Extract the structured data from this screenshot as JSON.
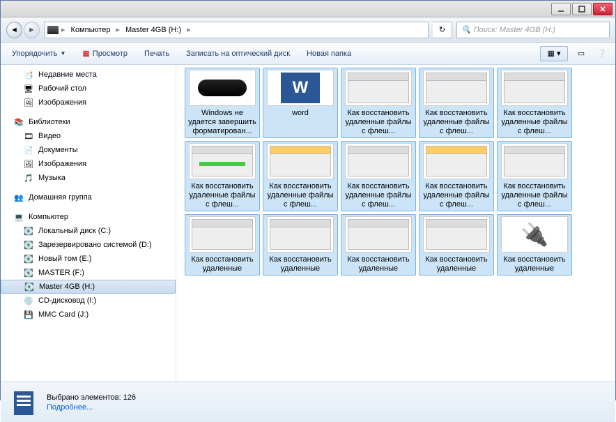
{
  "breadcrumb": {
    "root": "Компьютер",
    "current": "Master 4GB (H:)"
  },
  "search": {
    "placeholder": "Поиск: Master 4GB (H:)"
  },
  "toolbar": {
    "organize": "Упорядочить",
    "preview": "Просмотр",
    "print": "Печать",
    "burn": "Записать на оптический диск",
    "newfolder": "Новая папка"
  },
  "sidebar": {
    "fav": [
      {
        "label": "Недавние места",
        "icon": "📑"
      },
      {
        "label": "Рабочий стол",
        "icon": "🖥"
      },
      {
        "label": "Изображения",
        "icon": "🖼"
      }
    ],
    "lib_header": "Библиотеки",
    "lib": [
      {
        "label": "Видео",
        "icon": "🎞"
      },
      {
        "label": "Документы",
        "icon": "📄"
      },
      {
        "label": "Изображения",
        "icon": "🖼"
      },
      {
        "label": "Музыка",
        "icon": "🎵"
      }
    ],
    "home": "Домашняя группа",
    "comp_header": "Компьютер",
    "drives": [
      {
        "label": "Локальный диск (C:)",
        "icon": "💽"
      },
      {
        "label": "Зарезервировано системой (D:)",
        "icon": "💽"
      },
      {
        "label": "Новый том (E:)",
        "icon": "💽"
      },
      {
        "label": "MASTER (F:)",
        "icon": "💽"
      },
      {
        "label": "Master 4GB (H:)",
        "icon": "💽",
        "selected": true
      },
      {
        "label": "CD-дисковод (I:)",
        "icon": "💿"
      },
      {
        "label": "MMC Card (J:)",
        "icon": "💾"
      }
    ]
  },
  "files": [
    {
      "label": "Windows не удается завершить форматирован...",
      "t": "usb"
    },
    {
      "label": "word",
      "t": "word"
    },
    {
      "label": "Как восстановить удаленные файлы с флеш...",
      "t": "app"
    },
    {
      "label": "Как восстановить удаленные файлы с флеш...",
      "t": "app"
    },
    {
      "label": "Как восстановить удаленные файлы с флеш...",
      "t": "app"
    },
    {
      "label": "Как восстановить удаленные файлы с флеш...",
      "t": "green"
    },
    {
      "label": "Как восстановить удаленные файлы с флеш...",
      "t": "yellow"
    },
    {
      "label": "Как восстановить удаленные файлы с флеш...",
      "t": "app"
    },
    {
      "label": "Как восстановить удаленные файлы с флеш...",
      "t": "yellow"
    },
    {
      "label": "Как восстановить удаленные файлы с флеш...",
      "t": "app"
    },
    {
      "label": "Как восстановить удаленные",
      "t": "app"
    },
    {
      "label": "Как восстановить удаленные",
      "t": "app"
    },
    {
      "label": "Как восстановить удаленные",
      "t": "app"
    },
    {
      "label": "Как восстановить удаленные",
      "t": "app"
    },
    {
      "label": "Как восстановить удаленные",
      "t": "usbchar"
    }
  ],
  "status": {
    "text": "Выбрано элементов: 126",
    "more": "Подробнее..."
  }
}
